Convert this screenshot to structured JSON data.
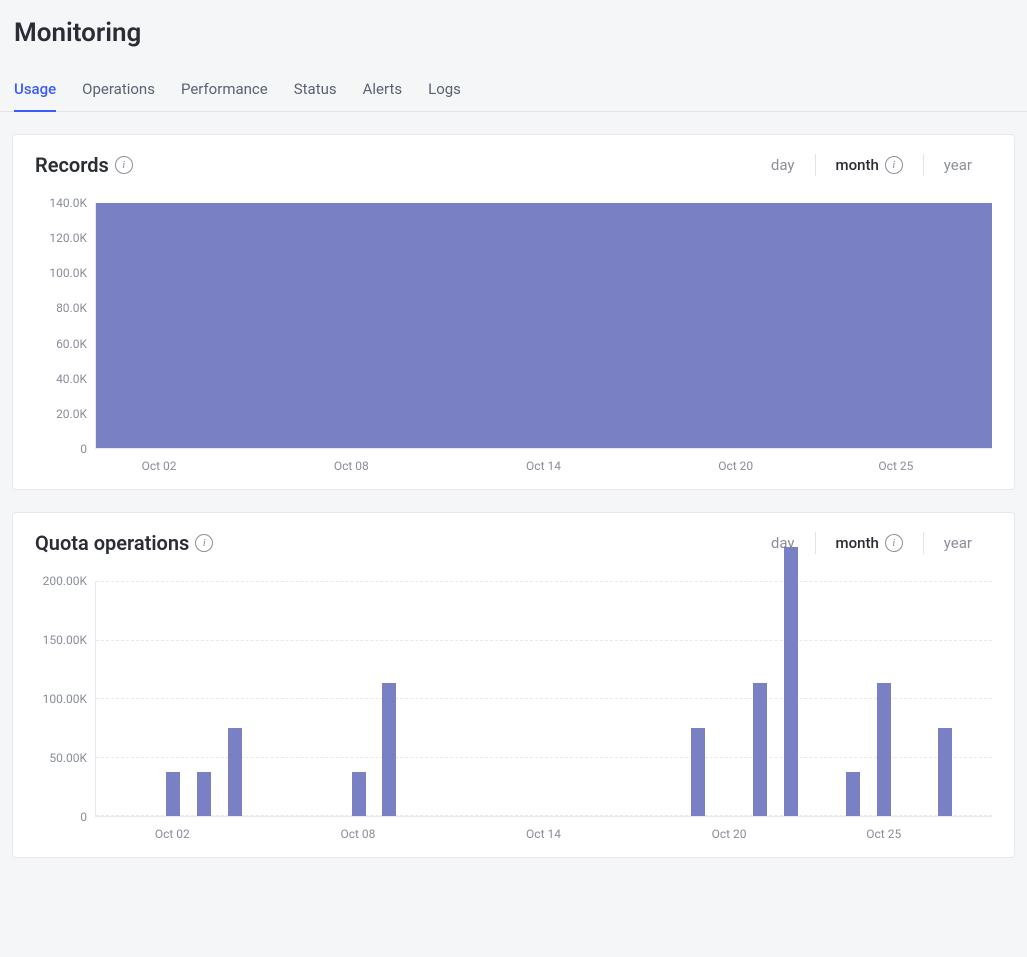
{
  "page": {
    "title": "Monitoring"
  },
  "tabs": [
    "Usage",
    "Operations",
    "Performance",
    "Status",
    "Alerts",
    "Logs"
  ],
  "activeTab": 0,
  "range": {
    "day": "day",
    "month": "month",
    "year": "year",
    "selected": "month"
  },
  "cards": {
    "records": {
      "title": "Records"
    },
    "quota": {
      "title": "Quota operations"
    }
  },
  "chart_data": [
    {
      "id": "records",
      "type": "area",
      "title": "Records",
      "ylabel": "",
      "xlabel": "",
      "yticks": [
        "140.0K",
        "120.0K",
        "100.0K",
        "80.0K",
        "60.0K",
        "40.0K",
        "20.0K",
        "0"
      ],
      "ylim": [
        0,
        140000
      ],
      "xticks": [
        "Oct 02",
        "Oct 08",
        "Oct 14",
        "Oct 20",
        "Oct 25"
      ],
      "x": [
        "Sep 30",
        "Oct 01",
        "Oct 02",
        "Oct 03",
        "Oct 04",
        "Oct 05",
        "Oct 06",
        "Oct 07",
        "Oct 08",
        "Oct 09",
        "Oct 10",
        "Oct 11",
        "Oct 12",
        "Oct 13",
        "Oct 14",
        "Oct 15",
        "Oct 16",
        "Oct 17",
        "Oct 18",
        "Oct 19",
        "Oct 20",
        "Oct 21",
        "Oct 22",
        "Oct 23",
        "Oct 24",
        "Oct 25",
        "Oct 26",
        "Oct 27",
        "Oct 28"
      ],
      "values": [
        143000,
        143000,
        143000,
        143000,
        143000,
        143000,
        143000,
        143000,
        143000,
        143000,
        143000,
        143000,
        143000,
        143000,
        143000,
        143000,
        143000,
        143000,
        143000,
        143000,
        143000,
        143000,
        145000,
        144000,
        144000,
        144000,
        143000,
        142000,
        142000
      ]
    },
    {
      "id": "quota",
      "type": "bar",
      "title": "Quota operations",
      "ylabel": "",
      "xlabel": "",
      "yticks": [
        "200.00K",
        "150.00K",
        "100.00K",
        "50.00K",
        "0"
      ],
      "ylim": [
        0,
        200000
      ],
      "xticks": [
        "Oct 02",
        "Oct 08",
        "Oct 14",
        "Oct 20",
        "Oct 25"
      ],
      "x": [
        "Sep 30",
        "Oct 01",
        "Oct 02",
        "Oct 03",
        "Oct 04",
        "Oct 05",
        "Oct 06",
        "Oct 07",
        "Oct 08",
        "Oct 09",
        "Oct 10",
        "Oct 11",
        "Oct 12",
        "Oct 13",
        "Oct 14",
        "Oct 15",
        "Oct 16",
        "Oct 17",
        "Oct 18",
        "Oct 19",
        "Oct 20",
        "Oct 21",
        "Oct 22",
        "Oct 23",
        "Oct 24",
        "Oct 25",
        "Oct 26",
        "Oct 27",
        "Oct 28"
      ],
      "values": [
        0,
        0,
        37500,
        37500,
        75000,
        0,
        0,
        0,
        37500,
        112500,
        0,
        0,
        0,
        0,
        0,
        0,
        0,
        0,
        0,
        75000,
        0,
        112500,
        228000,
        0,
        37500,
        112500,
        0,
        75000,
        0
      ]
    }
  ]
}
